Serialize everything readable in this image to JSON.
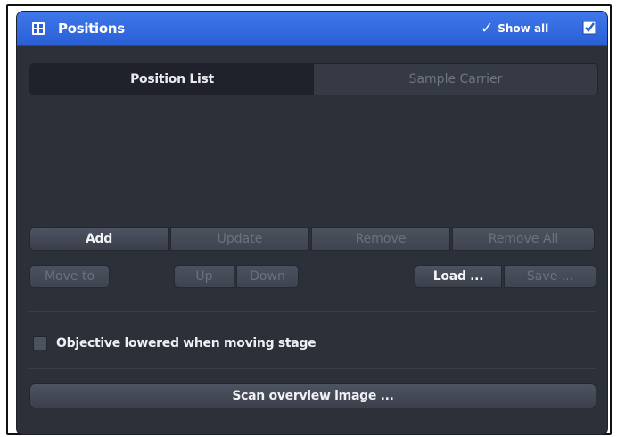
{
  "window": {
    "title": "Positions",
    "show_all_label": "Show all",
    "accent_color": "#3366dd"
  },
  "tabs": [
    {
      "label": "Position List",
      "active": true
    },
    {
      "label": "Sample Carrier",
      "active": false
    }
  ],
  "list_buttons": {
    "add": "Add",
    "update": "Update",
    "remove": "Remove",
    "remove_all": "Remove All"
  },
  "nav_buttons": {
    "move_to": "Move to",
    "up": "Up",
    "down": "Down",
    "load": "Load ...",
    "save": "Save ..."
  },
  "options": {
    "objective_lowered_label": "Objective lowered when moving stage",
    "objective_lowered_checked": false
  },
  "scan": {
    "label": "Scan overview image ..."
  }
}
